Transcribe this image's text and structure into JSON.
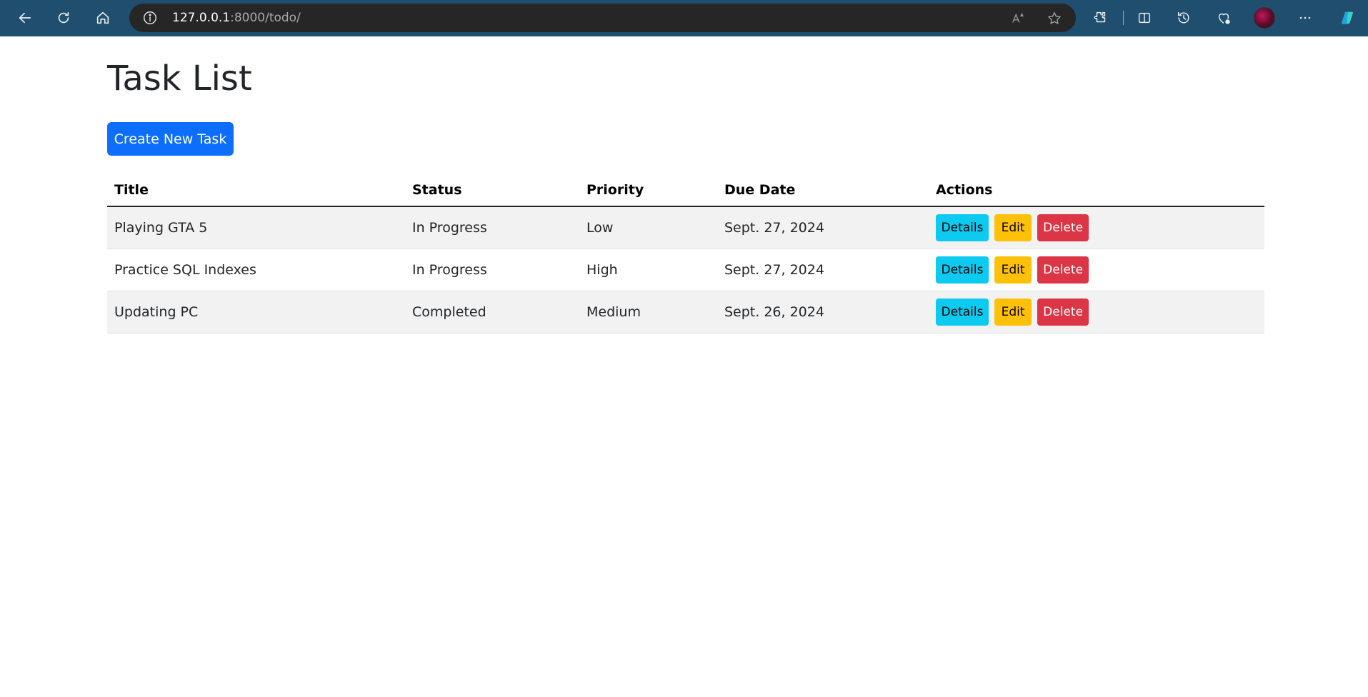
{
  "browser": {
    "url_host": "127.0.0.1",
    "url_path": ":8000/todo/",
    "icons": [
      "back-arrow-icon",
      "refresh-icon",
      "home-icon",
      "info-icon",
      "read-aloud-icon",
      "favorite-star-icon",
      "extensions-icon",
      "split-screen-icon",
      "history-icon",
      "browser-essentials-icon",
      "profile-avatar",
      "more-menu-icon",
      "copilot-icon"
    ],
    "toolbar_color": "#1f4e6e"
  },
  "page": {
    "title": "Task List",
    "create_button_label": "Create New Task",
    "accent_color": "#0d6efd"
  },
  "table": {
    "headers": {
      "title": "Title",
      "status": "Status",
      "priority": "Priority",
      "due_date": "Due Date",
      "actions": "Actions"
    },
    "rows": [
      {
        "title": "Playing GTA 5",
        "status": "In Progress",
        "priority": "Low",
        "due_date": "Sept. 27, 2024"
      },
      {
        "title": "Practice SQL Indexes",
        "status": "In Progress",
        "priority": "High",
        "due_date": "Sept. 27, 2024"
      },
      {
        "title": "Updating PC",
        "status": "Completed",
        "priority": "Medium",
        "due_date": "Sept. 26, 2024"
      }
    ],
    "actions": {
      "details_label": "Details",
      "edit_label": "Edit",
      "delete_label": "Delete"
    },
    "action_colors": {
      "details": "#0dcaf0",
      "edit": "#ffc107",
      "delete": "#dc3545"
    }
  }
}
